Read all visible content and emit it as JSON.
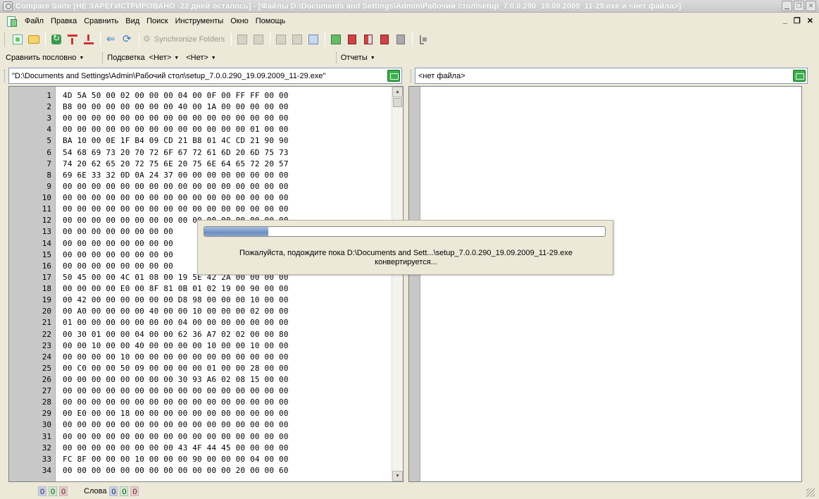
{
  "window": {
    "title": "Compare Suite [НЕ ЗАРЕГИСТРИРОВАНО -22 дней осталось] - [Файлы D:\\Documents and Settings\\Admin\\Рабочий стол\\setup_7.0.0.290_19.09.2009_11-29.exe и <нет файла>]",
    "mdi_controls": [
      "_",
      "❐",
      "✕"
    ]
  },
  "menu": [
    "Файл",
    "Правка",
    "Сравнить",
    "Вид",
    "Поиск",
    "Инструменты",
    "Окно",
    "Помощь"
  ],
  "toolbar": {
    "sync_label": "Synchronize Folders"
  },
  "toolbar2": {
    "compare_mode": "Сравнить  пословно",
    "highlight_label": "Подсветка",
    "highlight_left": "<Нет>",
    "highlight_right": "<Нет>",
    "reports": "Отчеты"
  },
  "left_file": {
    "path": "\"D:\\Documents and Settings\\Admin\\Рабочий стол\\setup_7.0.0.290_19.09.2009_11-29.exe\""
  },
  "right_file": {
    "path": "<нет файла>"
  },
  "hex_rows": [
    {
      "n": "1",
      "hex": "4D 5A 50 00 02 00 00 00 04 00 0F 00 FF FF 00 00"
    },
    {
      "n": "2",
      "hex": "B8 00 00 00 00 00 00 00 40 00 1A 00 00 00 00 00"
    },
    {
      "n": "3",
      "hex": "00 00 00 00 00 00 00 00 00 00 00 00 00 00 00 00"
    },
    {
      "n": "4",
      "hex": "00 00 00 00 00 00 00 00 00 00 00 00 00 01 00 00"
    },
    {
      "n": "5",
      "hex": "BA 10 00 0E 1F B4 09 CD 21 B8 01 4C CD 21 90 90"
    },
    {
      "n": "6",
      "hex": "54 68 69 73 20 70 72 6F 67 72 61 6D 20 6D 75 73"
    },
    {
      "n": "7",
      "hex": "74 20 62 65 20 72 75 6E 20 75 6E 64 65 72 20 57"
    },
    {
      "n": "8",
      "hex": "69 6E 33 32 0D 0A 24 37 00 00 00 00 00 00 00 00"
    },
    {
      "n": "9",
      "hex": "00 00 00 00 00 00 00 00 00 00 00 00 00 00 00 00"
    },
    {
      "n": "10",
      "hex": "00 00 00 00 00 00 00 00 00 00 00 00 00 00 00 00"
    },
    {
      "n": "11",
      "hex": "00 00 00 00 00 00 00 00 00 00 00 00 00 00 00 00"
    },
    {
      "n": "12",
      "hex": "00 00 00 00 00 00 00 00 00 00 00 00 00 00 00 00"
    },
    {
      "n": "13",
      "hex": "00 00 00 00 00 00 00 00"
    },
    {
      "n": "14",
      "hex": "00 00 00 00 00 00 00 00"
    },
    {
      "n": "15",
      "hex": "00 00 00 00 00 00 00 00"
    },
    {
      "n": "16",
      "hex": "00 00 00 00 00 00 00 00"
    },
    {
      "n": "17",
      "hex": "50 45 00 00 4C 01 08 00 19 5E 42 2A 00 00 00 00"
    },
    {
      "n": "18",
      "hex": "00 00 00 00 E0 00 8F 81 0B 01 02 19 00 90 00 00"
    },
    {
      "n": "19",
      "hex": "00 42 00 00 00 00 00 00 D8 98 00 00 00 10 00 00"
    },
    {
      "n": "20",
      "hex": "00 A0 00 00 00 00 40 00 00 10 00 00 00 02 00 00"
    },
    {
      "n": "21",
      "hex": "01 00 00 00 00 00 00 00 04 00 00 00 00 00 00 00"
    },
    {
      "n": "22",
      "hex": "00 30 01 00 00 04 00 00 62 36 A7 02 02 00 00 80"
    },
    {
      "n": "23",
      "hex": "00 00 10 00 00 40 00 00 00 00 10 00 00 10 00 00"
    },
    {
      "n": "24",
      "hex": "00 00 00 00 10 00 00 00 00 00 00 00 00 00 00 00"
    },
    {
      "n": "25",
      "hex": "00 C0 00 00 50 09 00 00 00 00 01 00 00 28 00 00"
    },
    {
      "n": "26",
      "hex": "00 00 00 00 00 00 00 00 30 93 A6 02 08 15 00 00"
    },
    {
      "n": "27",
      "hex": "00 00 00 00 00 00 00 00 00 00 00 00 00 00 00 00"
    },
    {
      "n": "28",
      "hex": "00 00 00 00 00 00 00 00 00 00 00 00 00 00 00 00"
    },
    {
      "n": "29",
      "hex": "00 E0 00 00 18 00 00 00 00 00 00 00 00 00 00 00"
    },
    {
      "n": "30",
      "hex": "00 00 00 00 00 00 00 00 00 00 00 00 00 00 00 00"
    },
    {
      "n": "31",
      "hex": "00 00 00 00 00 00 00 00 00 00 00 00 00 00 00 00"
    },
    {
      "n": "32",
      "hex": "00 00 00 00 00 00 00 00 43 4F 44 45 00 00 00 00"
    },
    {
      "n": "33",
      "hex": "FC 8F 00 00 00 10 00 00 00 90 00 00 00 04 00 00"
    },
    {
      "n": "34",
      "hex": "00 00 00 00 00 00 00 00 00 00 00 00 20 00 00 60"
    }
  ],
  "progress_dialog": {
    "progress_fraction": 0.16,
    "message_line1": "Пожалуйста, подождите пока D:\\Documents and Sett...\\setup_7.0.0.290_19.09.2009_11-29.exe",
    "message_line2": "конвертируется..."
  },
  "statusbar": {
    "counts_left": [
      "0",
      "0",
      "0"
    ],
    "words_label": "Слова",
    "counts_words": [
      "0",
      "0",
      "0"
    ]
  }
}
